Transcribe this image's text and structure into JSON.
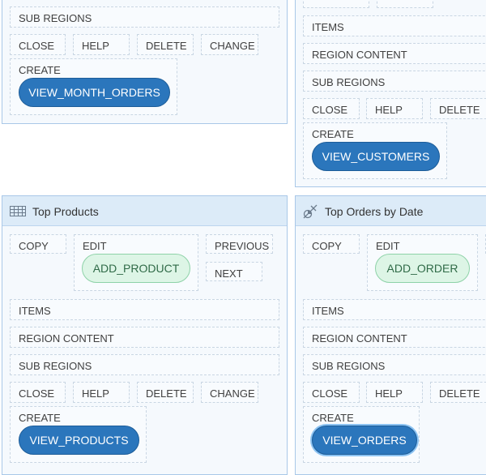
{
  "slot_labels": {
    "copy": "COPY",
    "edit": "EDIT",
    "previous": "PREVIOUS",
    "next": "NEXT",
    "items": "ITEMS",
    "region_content": "REGION CONTENT",
    "sub_regions": "SUB REGIONS",
    "close": "CLOSE",
    "help": "HELP",
    "delete": "DELETE",
    "change": "CHANGE",
    "create": "CREATE"
  },
  "panels": {
    "top_left": {
      "create_button": "VIEW_MONTH_ORDERS"
    },
    "top_right": {
      "create_button": "VIEW_CUSTOMERS"
    },
    "top_products": {
      "title": "Top Products",
      "icon": "table-icon",
      "edit_button": "ADD_PRODUCT",
      "create_button": "VIEW_PRODUCTS"
    },
    "top_orders_by_date": {
      "title": "Top Orders by Date",
      "icon": "chart-icon",
      "edit_button": "ADD_ORDER",
      "create_button": "VIEW_ORDERS"
    }
  },
  "colors": {
    "primary_button": "#2b76bc",
    "secondary_button": "#ddf5e6",
    "panel_header": "#dcebf8",
    "panel_border": "#a9c8e8"
  }
}
